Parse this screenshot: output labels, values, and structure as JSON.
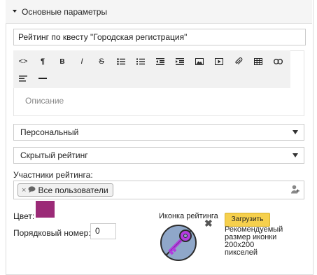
{
  "section": {
    "title": "Основные параметры"
  },
  "rating_title": {
    "value": "Рейтинг по квесту \"Городская регистрация\""
  },
  "editor": {
    "toolbar": [
      "code",
      "paragraph",
      "bold",
      "italic",
      "strikethrough",
      "unordered-list",
      "ordered-list",
      "outdent",
      "indent",
      "image",
      "video",
      "link",
      "table",
      "link-alt",
      "align",
      "horizontal-rule"
    ],
    "toolbar_glyphs": {
      "code": "<>",
      "paragraph": "¶",
      "bold": "B",
      "italic": "I",
      "strikethrough": "S"
    },
    "placeholder": "Описание"
  },
  "type_select": {
    "value": "Персональный"
  },
  "visibility_select": {
    "value": "Скрытый рейтинг"
  },
  "participants": {
    "label": "Участники рейтинга:",
    "tags": [
      {
        "label": "Все пользователи",
        "remove": "×"
      }
    ]
  },
  "color": {
    "label": "Цвет:",
    "value": "#9b2a77"
  },
  "order": {
    "label": "Порядковый номер:",
    "value": "0"
  },
  "rating_icon": {
    "label": "Иконка рейтинга",
    "remove": "✖",
    "upload_label": "Загрузить",
    "hint": "Рекомендуемый размер иконки 200x200 пикселей"
  }
}
